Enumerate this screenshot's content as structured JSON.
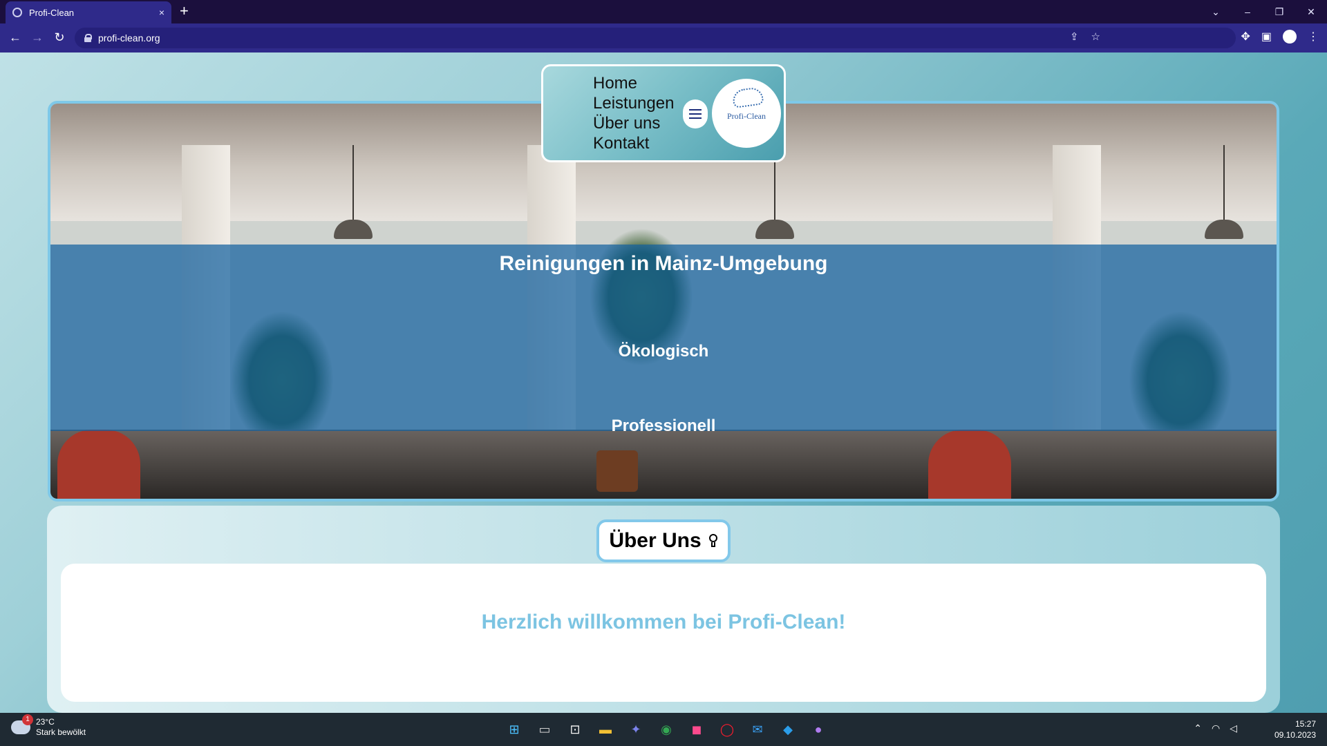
{
  "browser": {
    "tab_title": "Profi-Clean",
    "tab_close": "×",
    "new_tab": "+",
    "url": "profi-clean.org",
    "window_controls": [
      "⌄",
      "–",
      "❐",
      "✕"
    ]
  },
  "site": {
    "nav": {
      "items": [
        "Home",
        "Leistungen",
        "Über uns",
        "Kontakt"
      ],
      "logo_text": "Profi-Clean"
    },
    "hero": {
      "title": "Reinigungen in Mainz-Umgebung",
      "line1": "Ökologisch",
      "line2": "Professionell"
    },
    "about": {
      "heading": "Über Uns",
      "welcome": "Herzlich willkommen bei Profi-Clean!"
    }
  },
  "taskbar": {
    "weather_temp": "23°C",
    "weather_desc": "Stark bewölkt",
    "notification_count": "1",
    "time": "15:27",
    "date": "09.10.2023",
    "apps": [
      "start-icon",
      "task-view-icon",
      "store-icon",
      "explorer-icon",
      "teams-icon",
      "chrome-icon",
      "jetbrains-icon",
      "opera-icon",
      "mail-icon",
      "vscode-icon",
      "github-icon"
    ]
  },
  "colors": {
    "tab_bar": "#1b0f3d",
    "toolbar": "#2f2a8a",
    "overlay": "#1461a0",
    "accent": "#7cc4e2",
    "taskbar": "#1f2a33"
  }
}
